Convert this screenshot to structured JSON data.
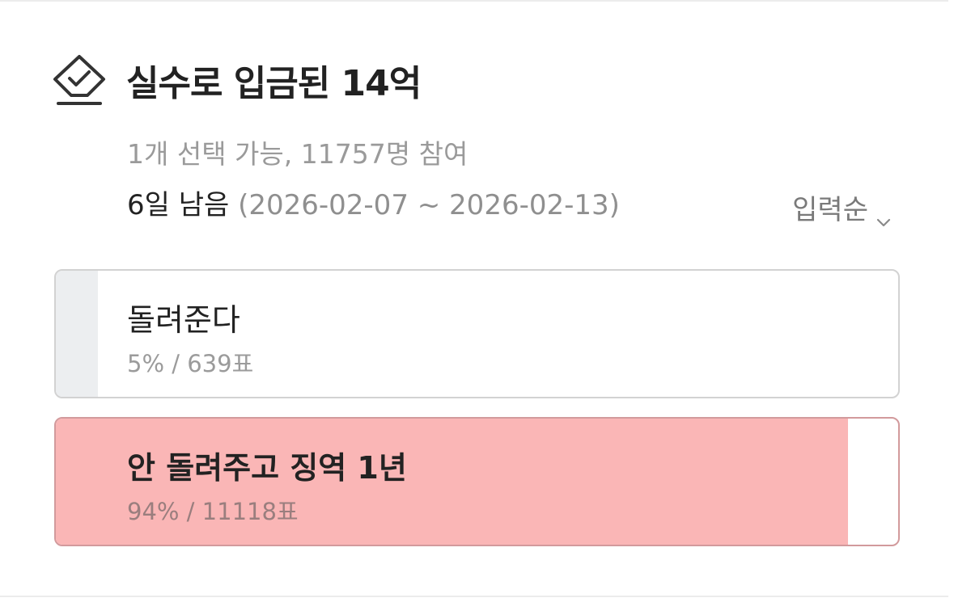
{
  "poll": {
    "title": "실수로 입금된 14억",
    "meta": "1개 선택 가능, 11757명 참여",
    "remaining": "6일 남음",
    "date_range": "(2026-02-07 ~ 2026-02-13)",
    "sort_label": "입력순",
    "icon": "check-diamond-icon",
    "options": [
      {
        "label": "돌려준다",
        "stats": "5% / 639표",
        "percent": 5,
        "votes": 639,
        "selected": false,
        "fill_color": "#eceef0"
      },
      {
        "label": "안 돌려주고 징역 1년",
        "stats": "94% / 11118표",
        "percent": 94,
        "votes": 11118,
        "selected": true,
        "fill_color": "#fab6b6"
      }
    ]
  }
}
